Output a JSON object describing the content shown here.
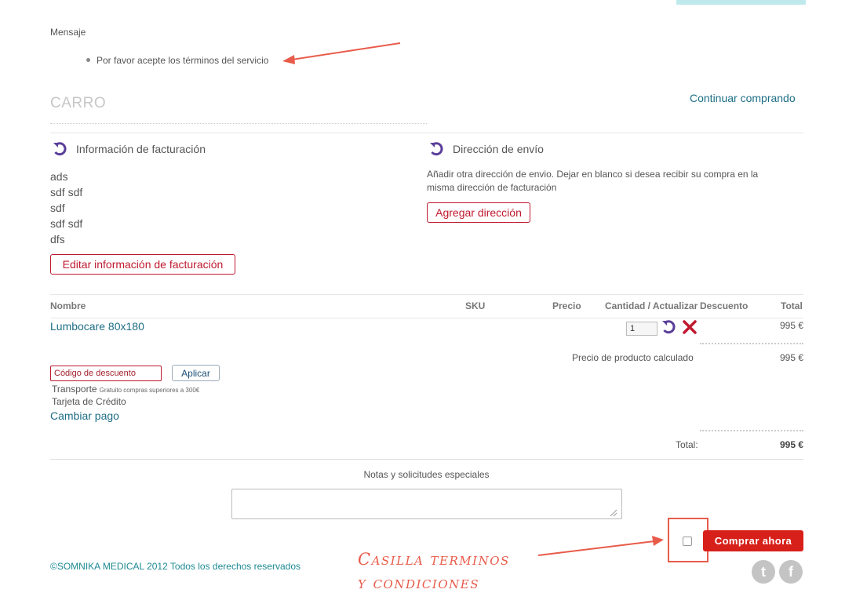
{
  "message": {
    "label": "Mensaje",
    "items": [
      "Por favor acepte los términos del servicio"
    ]
  },
  "cart": {
    "title": "CARRO",
    "continue_link": "Continuar comprando"
  },
  "billing": {
    "heading": "Información de facturación",
    "lines": [
      "ads",
      "sdf sdf",
      "sdf",
      "sdf sdf",
      "dfs"
    ],
    "edit_button": "Editar información de facturación"
  },
  "shipping": {
    "heading": "Dirección de envío",
    "description": "Añadir otra dirección de envio. Dejar en blanco si desea recibir su compra en la misma dirección de facturación",
    "add_button": "Agregar dirección"
  },
  "table": {
    "headers": {
      "name": "Nombre",
      "sku": "SKU",
      "price": "Precio",
      "qty": "Cantidad / Actualizar",
      "discount": "Descuento",
      "total": "Total"
    },
    "rows": [
      {
        "name": "Lumbocare 80x180",
        "qty": "1",
        "total": "995 €"
      }
    ]
  },
  "summary": {
    "calc_label": "Precio de producto calculado",
    "calc_value": "995 €",
    "total_label": "Total:",
    "total_value": "995 €"
  },
  "coupon": {
    "placeholder": "Código de descuento",
    "apply_button": "Aplicar"
  },
  "shipping_info": {
    "label": "Transporte",
    "note": "Gratuito compras superiores a 300€"
  },
  "payment": {
    "method": "Tarjeta de Crédito",
    "change_link": "Cambiar pago"
  },
  "notes": {
    "label": "Notas y solicitudes especiales"
  },
  "checkout": {
    "buy_button": "Comprar ahora"
  },
  "annotation": {
    "line1": "Casilla terminos",
    "line2": "y condiciones"
  },
  "footer": {
    "text": "©SOMNIKA MEDICAL 2012 Todos los derechos reservados"
  },
  "social": {
    "twitter": "t",
    "facebook": "f"
  },
  "colors": {
    "accent_red": "#d8201a",
    "link_teal": "#1d6e85",
    "annotation": "#e85b4a",
    "icon_purple": "#5b3e9a"
  },
  "icons": [
    "refresh-icon",
    "remove-icon",
    "twitter-icon",
    "facebook-icon",
    "resize-grip-icon"
  ]
}
